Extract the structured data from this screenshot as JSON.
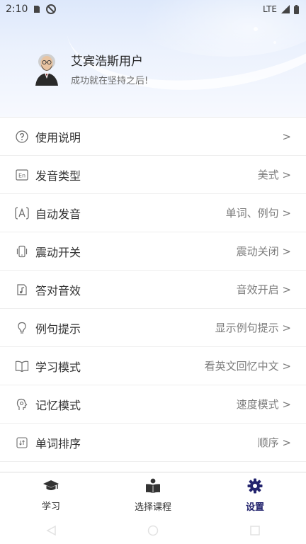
{
  "status_bar": {
    "time": "2:10",
    "network": "LTE",
    "icons": [
      "sim-card-icon",
      "do-not-disturb-icon",
      "signal-icon",
      "battery-icon"
    ]
  },
  "profile": {
    "name": "艾宾浩斯用户",
    "motto": "成功就在坚持之后!"
  },
  "settings": [
    {
      "icon": "help-circle-icon",
      "label": "使用说明",
      "value": ">"
    },
    {
      "icon": "en-badge-icon",
      "label": "发音类型",
      "value": "美式 >"
    },
    {
      "icon": "auto-speak-icon",
      "label": "自动发音",
      "value": "单词、例句 >"
    },
    {
      "icon": "vibrate-icon",
      "label": "震动开关",
      "value": "震动关闭 >"
    },
    {
      "icon": "sound-effect-icon",
      "label": "答对音效",
      "value": "音效开启 >"
    },
    {
      "icon": "lightbulb-icon",
      "label": "例句提示",
      "value": "显示例句提示 >"
    },
    {
      "icon": "book-icon",
      "label": "学习模式",
      "value": "看英文回忆中文 >"
    },
    {
      "icon": "head-memory-icon",
      "label": "记忆模式",
      "value": "速度模式 >"
    },
    {
      "icon": "sort-icon",
      "label": "单词排序",
      "value": "顺序 >"
    }
  ],
  "bottom_nav": {
    "items": [
      {
        "icon": "graduation-cap-icon",
        "label": "学习",
        "active": false
      },
      {
        "icon": "reading-person-icon",
        "label": "选择课程",
        "active": false
      },
      {
        "icon": "gear-icon",
        "label": "设置",
        "active": true
      }
    ]
  },
  "colors": {
    "active_nav": "#23246e",
    "header_gradient_top": "#dde8fb",
    "text_primary": "#333333",
    "text_secondary": "#7c7c7c"
  }
}
